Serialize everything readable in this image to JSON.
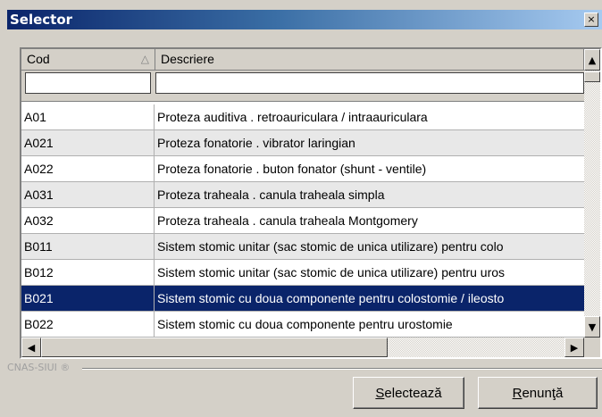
{
  "window": {
    "title": "Selector",
    "close_icon": "×"
  },
  "grid": {
    "columns": [
      {
        "label": "Cod",
        "sort": "ascending"
      },
      {
        "label": "Descriere"
      }
    ],
    "filters": {
      "cod_value": "",
      "desc_value": ""
    },
    "rows": [
      {
        "cod": "A01",
        "descriere": "Proteza auditiva . retroauriculara / intraauriculara"
      },
      {
        "cod": "A021",
        "descriere": "Proteza fonatorie . vibrator laringian"
      },
      {
        "cod": "A022",
        "descriere": "Proteza fonatorie . buton fonator (shunt - ventile)"
      },
      {
        "cod": "A031",
        "descriere": "Proteza traheala . canula traheala simpla"
      },
      {
        "cod": "A032",
        "descriere": "Proteza traheala . canula traheala Montgomery"
      },
      {
        "cod": "B011",
        "descriere": "Sistem stomic unitar (sac stomic de unica utilizare) pentru colo"
      },
      {
        "cod": "B012",
        "descriere": "Sistem stomic unitar (sac stomic de unica utilizare) pentru uros"
      },
      {
        "cod": "B021",
        "descriere": "Sistem stomic cu doua componente pentru colostomie / ileosto"
      },
      {
        "cod": "B022",
        "descriere": "Sistem stomic cu doua componente pentru urostomie"
      }
    ],
    "selected_cod": "B021"
  },
  "footer": {
    "brand": "CNAS-SIUI ®"
  },
  "buttons": {
    "select_first": "S",
    "select_rest": "electează",
    "cancel_first": "R",
    "cancel_rest": "enunţă"
  }
}
